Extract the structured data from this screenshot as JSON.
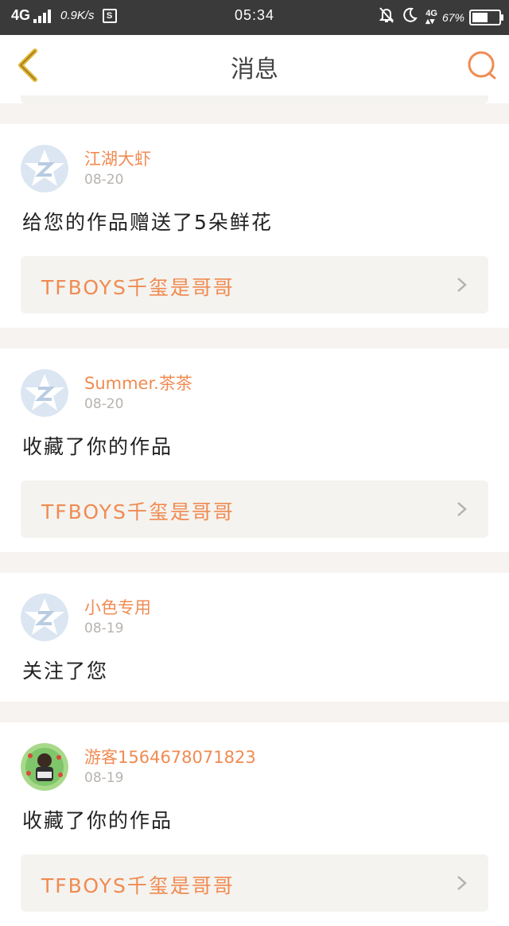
{
  "status_bar": {
    "network": "4G",
    "speed": "0.9K/s",
    "time": "05:34",
    "network2": "4G",
    "battery_pct": "67%",
    "battery_level": 0.67
  },
  "header": {
    "title": "消息",
    "back_icon": "chevron-left-icon",
    "search_icon": "search-icon"
  },
  "colors": {
    "accent": "#f08b52",
    "back": "#e2b533",
    "card_bg": "#ffffff",
    "ref_bg": "#f4f3ef",
    "page_bg": "#f6f3f1"
  },
  "messages": [
    {
      "username": "江湖大虾",
      "date": "08-20",
      "action": "给您的作品赠送了5朵鲜花",
      "ref_title": "TFBOYS千玺是哥哥",
      "avatar": "default-avatar"
    },
    {
      "username": "Summer.茶茶",
      "date": "08-20",
      "action": "收藏了你的作品",
      "ref_title": "TFBOYS千玺是哥哥",
      "avatar": "default-avatar"
    },
    {
      "username": "小色专用",
      "date": "08-19",
      "action": "关注了您",
      "avatar": "default-avatar"
    },
    {
      "username": "游客1564678071823",
      "date": "08-19",
      "action": "收藏了你的作品",
      "ref_title": "TFBOYS千玺是哥哥",
      "avatar": "photo-avatar"
    }
  ]
}
